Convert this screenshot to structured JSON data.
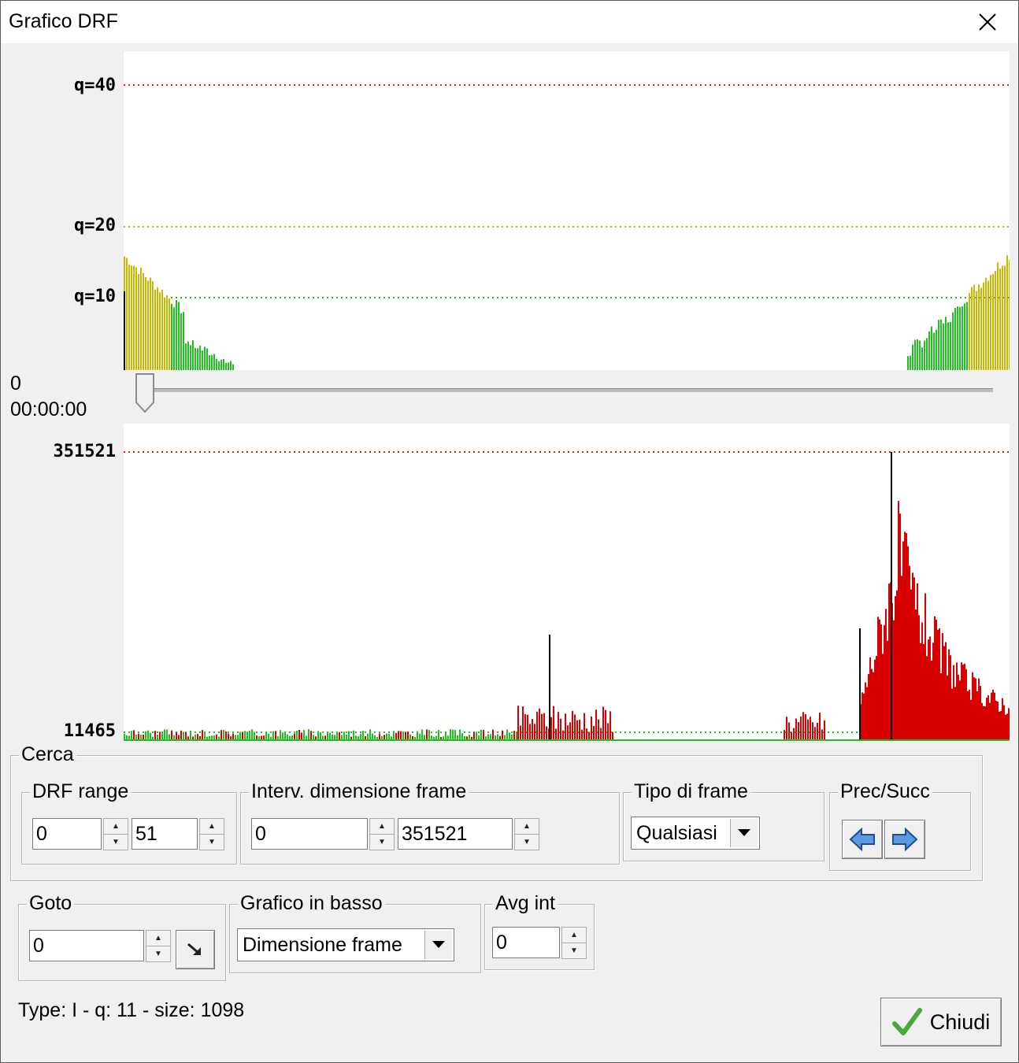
{
  "window": {
    "title": "Grafico DRF"
  },
  "chart_data": [
    {
      "type": "bar",
      "y_ticks": [
        "q=40",
        "q=20",
        "q=10"
      ],
      "ylim": [
        0,
        45
      ],
      "colors": {
        "green": "#1ec01e",
        "yellow": "#c8b800",
        "red": "#e02020"
      },
      "segments": [
        {
          "x_range": [
            0,
            140
          ],
          "values_range": [
            2,
            14
          ]
        },
        {
          "x_range": [
            995,
            1125
          ],
          "values_range": [
            2,
            16
          ]
        }
      ]
    },
    {
      "type": "bar",
      "y_ticks": [
        "351521",
        "11465"
      ],
      "ylim": [
        11465,
        351521
      ],
      "colors": {
        "green": "#1ec01e",
        "red": "#d80000"
      }
    }
  ],
  "position": {
    "frame": "0",
    "time": "00:00:00"
  },
  "search": {
    "label": "Cerca",
    "drf_range": {
      "label": "DRF range",
      "min": "0",
      "max": "51"
    },
    "frame_size": {
      "label": "Interv. dimensione frame",
      "min": "0",
      "max": "351521"
    },
    "frame_type": {
      "label": "Tipo di frame",
      "value": "Qualsiasi"
    },
    "prev_next": {
      "label": "Prec/Succ"
    }
  },
  "goto": {
    "label": "Goto",
    "value": "0"
  },
  "bottom_graph": {
    "label": "Grafico in basso",
    "value": "Dimensione frame"
  },
  "avg_int": {
    "label": "Avg int",
    "value": "0"
  },
  "status": "Type: I - q: 11 - size: 1098",
  "close_button": {
    "label": "Chiudi"
  }
}
